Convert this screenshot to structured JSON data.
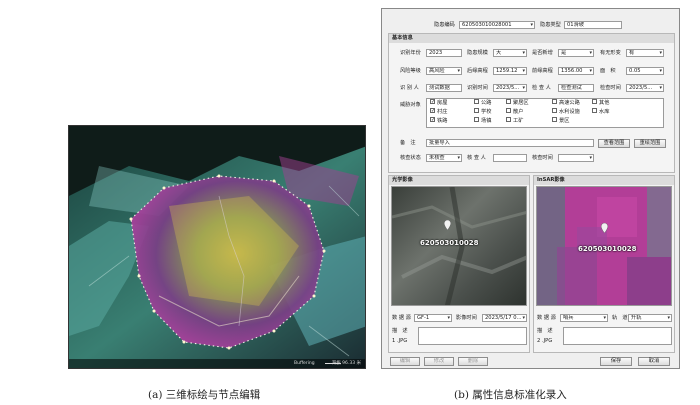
{
  "left_view": {
    "footer_left": "Buffering",
    "footer_right": "海拔 96.33 米",
    "caption": "(a) 三维标绘与节点编辑"
  },
  "form": {
    "hazard_code_label": "隐患编码",
    "hazard_code_value": "620503010028001",
    "hazard_type_label": "隐患类型",
    "hazard_type_value": "01滑坡",
    "basic": {
      "title": "基本信息",
      "year_label": "识别年份",
      "year_value": "2023",
      "scale_label": "隐患规模",
      "scale_value": "大",
      "new_label": "是否新增",
      "new_value": "是",
      "deform_label": "有无形变",
      "deform_value": "有",
      "risk_label": "风险等级",
      "risk_value": "高风险",
      "top_elev_label": "后缘高程",
      "top_elev_value": "1259.12",
      "bottom_elev_label": "前缘高程",
      "bottom_elev_value": "1356.00",
      "area_label": "面　积",
      "area_value": "0.05",
      "identifier_label": "识 别 人",
      "identifier_value": "测试数据",
      "id_time_label": "识别时间",
      "id_time_value": "2023/5...",
      "checker_label": "检 查 人",
      "checker_value": "检查测试",
      "check_time_label": "检查时间",
      "check_time_value": "2023/5...",
      "threat_label": "威胁对象",
      "threats": [
        {
          "label": "房屋",
          "checked": true
        },
        {
          "label": "公路",
          "checked": false
        },
        {
          "label": "聚居区",
          "checked": false
        },
        {
          "label": "高速公路",
          "checked": false
        },
        {
          "label": "其他",
          "checked": false
        },
        {
          "label": "村庄",
          "checked": true
        },
        {
          "label": "学校",
          "checked": false
        },
        {
          "label": "散户",
          "checked": false
        },
        {
          "label": "水利设施",
          "checked": false
        },
        {
          "label": "水库",
          "checked": false
        },
        {
          "label": "铁路",
          "checked": true
        },
        {
          "label": "场镇",
          "checked": false
        },
        {
          "label": "工矿",
          "checked": false
        },
        {
          "label": "景区",
          "checked": false
        }
      ],
      "remark_label": "备　注",
      "remark_value": "批量导入",
      "view_range_btn": "查看范围",
      "redraw_range_btn": "重绘范围",
      "verify_status_label": "核查状态",
      "verify_status_value": "未核查",
      "verifier_label": "核 查 人",
      "verifier_value": "",
      "verify_time_label": "核查时间",
      "verify_time_value": ""
    },
    "optical": {
      "title": "光学影像",
      "pin_label": "620503010028",
      "source_label": "数 据 源",
      "source_value": "GF-1",
      "time_label": "影像时间",
      "time_value": "2023/5/17 0...",
      "desc_label": "描　述",
      "file_label": "1 .JPG"
    },
    "insar": {
      "title": "InSAR影像",
      "pin_label": "620503010028",
      "source_label": "数 据 源",
      "source_value": "哨兵",
      "track_label": "轨　道",
      "track_value": "升轨",
      "desc_label": "描　述",
      "file_label": "2 .JPG"
    },
    "buttons": {
      "edit": "编辑",
      "modify": "修改",
      "delete": "删除",
      "save": "保存",
      "cancel": "取消"
    },
    "caption": "(b) 属性信息标准化录入"
  }
}
